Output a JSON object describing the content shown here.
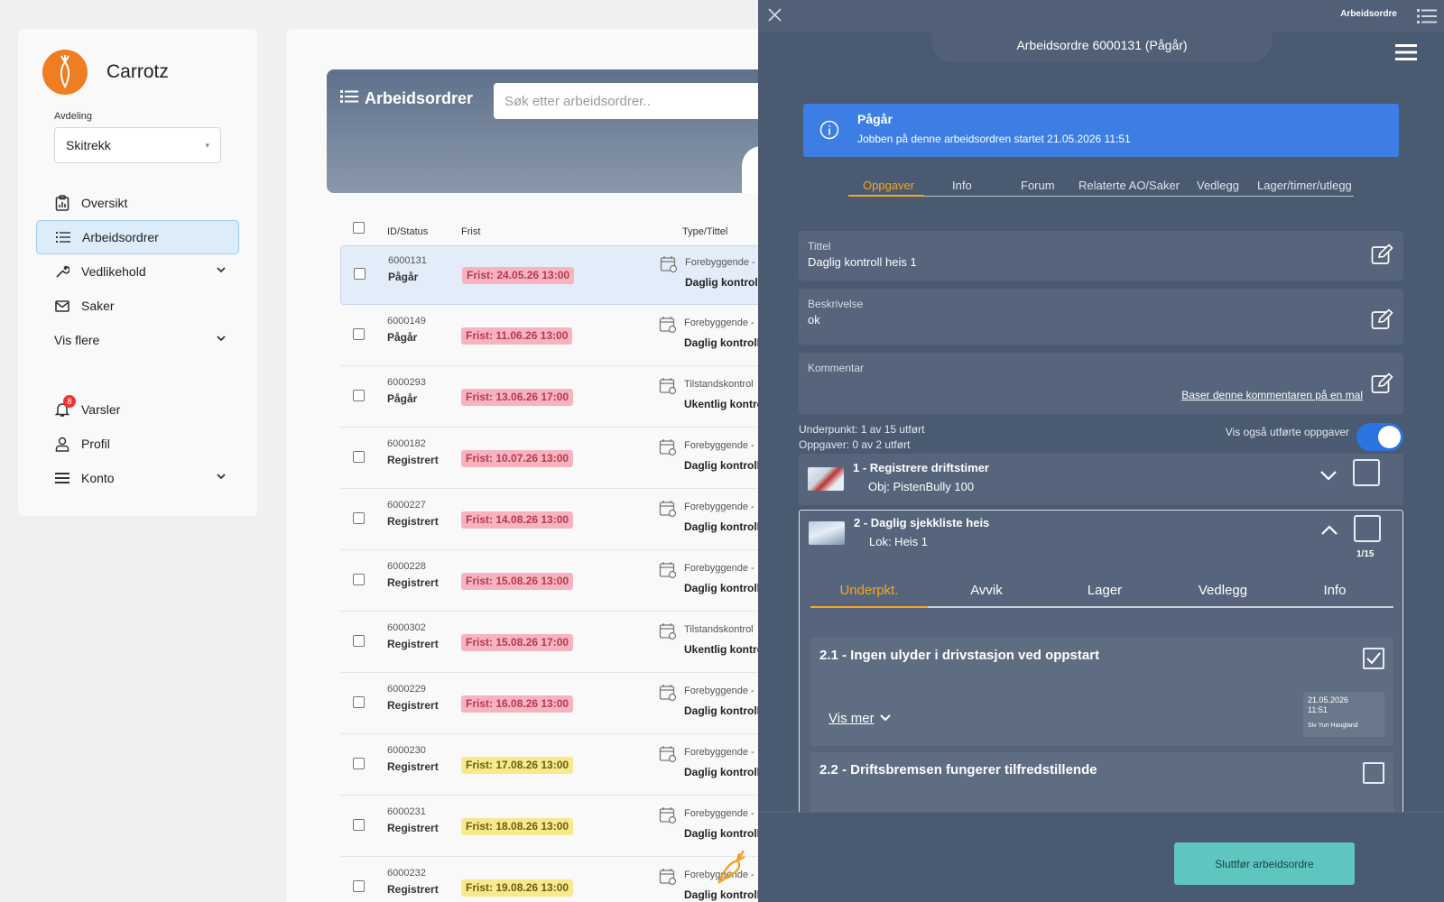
{
  "sidebar": {
    "brand": "Carrotz",
    "department_label": "Avdeling",
    "department_value": "Skitrekk",
    "items": [
      {
        "label": "Oversikt"
      },
      {
        "label": "Arbeidsordrer"
      },
      {
        "label": "Vedlikehold"
      },
      {
        "label": "Saker"
      },
      {
        "label": "Vis flere"
      },
      {
        "label": "Varsler",
        "badge": "8"
      },
      {
        "label": "Profil"
      },
      {
        "label": "Konto"
      }
    ]
  },
  "main": {
    "title": "Arbeidsordrer",
    "search_placeholder": "Søk etter arbeidsordrer..",
    "columns": [
      "ID/Status",
      "Frist",
      "Type/Tittel"
    ],
    "rows": [
      {
        "id": "6000131",
        "status": "Pågår",
        "frist": "Frist: 24.05.26 13:00",
        "color": "pink",
        "type": "Forebyggende -",
        "title": "Daglig kontroll"
      },
      {
        "id": "6000149",
        "status": "Pågår",
        "frist": "Frist: 11.06.26 13:00",
        "color": "pink",
        "type": "Forebyggende -",
        "title": "Daglig kontroll"
      },
      {
        "id": "6000293",
        "status": "Pågår",
        "frist": "Frist: 13.06.26 17:00",
        "color": "pink",
        "type": "Tilstandskontrol",
        "title": "Ukentlig kontro"
      },
      {
        "id": "6000182",
        "status": "Registrert",
        "frist": "Frist: 10.07.26 13:00",
        "color": "pink",
        "type": "Forebyggende -",
        "title": "Daglig kontroll"
      },
      {
        "id": "6000227",
        "status": "Registrert",
        "frist": "Frist: 14.08.26 13:00",
        "color": "pink",
        "type": "Forebyggende -",
        "title": "Daglig kontroll"
      },
      {
        "id": "6000228",
        "status": "Registrert",
        "frist": "Frist: 15.08.26 13:00",
        "color": "pink",
        "type": "Forebyggende -",
        "title": "Daglig kontroll"
      },
      {
        "id": "6000302",
        "status": "Registrert",
        "frist": "Frist: 15.08.26 17:00",
        "color": "pink",
        "type": "Tilstandskontrol",
        "title": "Ukentlig kontro"
      },
      {
        "id": "6000229",
        "status": "Registrert",
        "frist": "Frist: 16.08.26 13:00",
        "color": "pink",
        "type": "Forebyggende -",
        "title": "Daglig kontroll"
      },
      {
        "id": "6000230",
        "status": "Registrert",
        "frist": "Frist: 17.08.26 13:00",
        "color": "yellow",
        "type": "Forebyggende -",
        "title": "Daglig kontroll"
      },
      {
        "id": "6000231",
        "status": "Registrert",
        "frist": "Frist: 18.08.26 13:00",
        "color": "yellow",
        "type": "Forebyggende -",
        "title": "Daglig kontroll"
      },
      {
        "id": "6000232",
        "status": "Registrert",
        "frist": "Frist: 19.08.26 13:00",
        "color": "yellow",
        "type": "Forebyggende -",
        "title": "Daglig kontroll"
      }
    ]
  },
  "panel": {
    "top_label": "Arbeidsordre",
    "title": "Arbeidsordre 6000131 (Pågår)",
    "info_title": "Pågår",
    "info_text": "Jobben på denne arbeidsordren startet 21.05.2026 11:51",
    "tabs": [
      "Oppgaver",
      "Info",
      "Forum",
      "Relaterte AO/Saker",
      "Vedlegg",
      "Lager/timer/utlegg"
    ],
    "fields": {
      "tittel_label": "Tittel",
      "tittel_value": "Daglig kontroll heis 1",
      "beskrivelse_label": "Beskrivelse",
      "beskrivelse_value": "ok",
      "kommentar_label": "Kommentar",
      "kommentar_link": "Baser denne kommentaren på en mal"
    },
    "underpunkt_text": "Underpunkt: 1 av 15 utført",
    "oppgaver_text": "Oppgaver: 0 av 2 utført",
    "toggle_label": "Vis også utførte oppgaver",
    "toggle_on": true,
    "task1": {
      "title": "1 - Registrere driftstimer",
      "sub": "Obj: PistenBully 100"
    },
    "task2": {
      "title": "2 - Daglig sjekkliste heis",
      "sub": "Lok: Heis 1",
      "count": "1/15"
    },
    "subtabs": [
      "Underpkt.",
      "Avvik",
      "Lager",
      "Vedlegg",
      "Info"
    ],
    "subitems": [
      {
        "title": "2.1 - Ingen ulyder i drivstasjon ved oppstart",
        "checked": true,
        "vis_mer": "Vis mer",
        "stamp_date": "21.05.2026",
        "stamp_time": "11:51",
        "stamp_user": "Siv Yun Haugland"
      },
      {
        "title": "2.2 - Driftsbremsen fungerer tilfredstillende",
        "checked": false
      }
    ],
    "finish_button": "Sluttfør arbeidsordre"
  },
  "colors": {
    "accent": "#f5a623",
    "panel": "#4a5a70",
    "info": "#3c7ee3",
    "finish": "#5fc6bf",
    "brand": "#ef7d22"
  }
}
